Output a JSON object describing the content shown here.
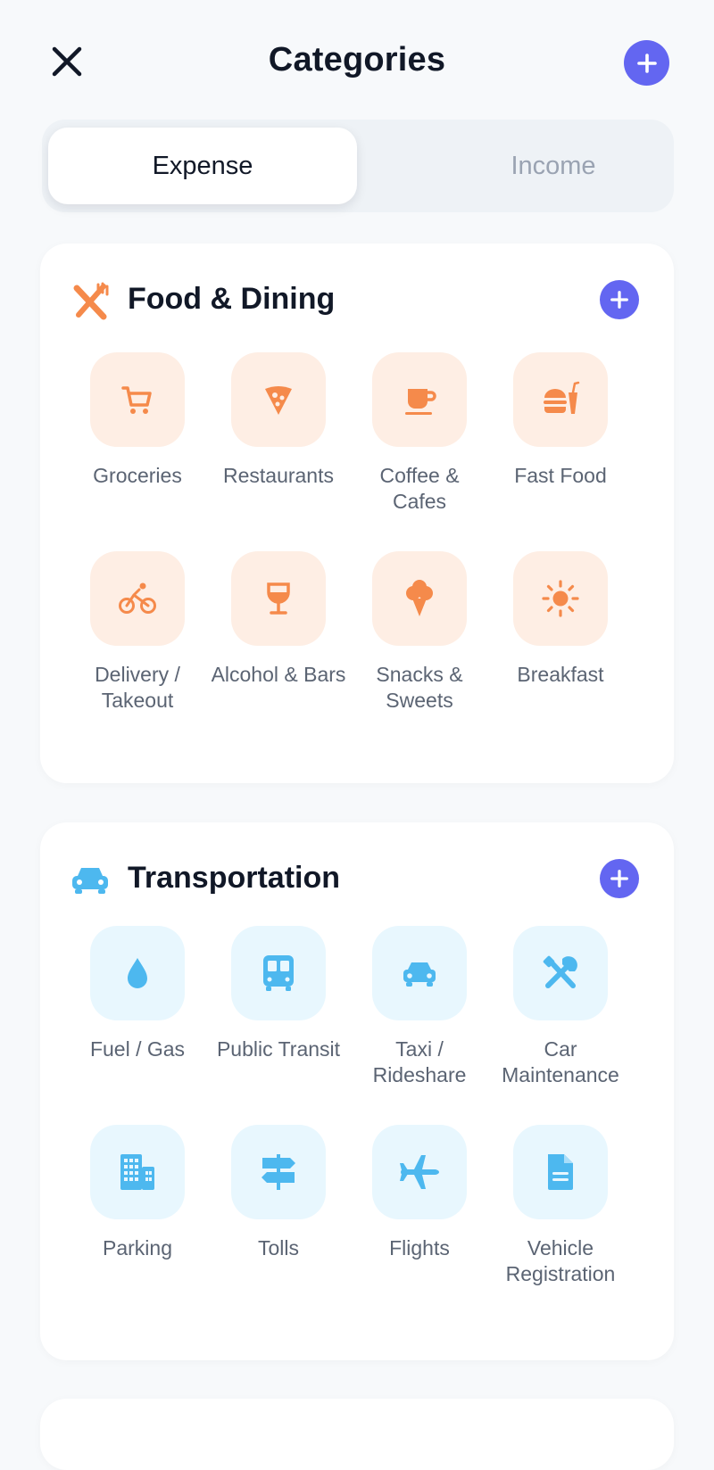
{
  "header": {
    "title": "Categories",
    "close_icon": "close-icon",
    "add_icon": "plus-icon"
  },
  "tabs": [
    {
      "label": "Expense",
      "active": true
    },
    {
      "label": "Income",
      "active": false
    }
  ],
  "colors": {
    "accent": "#6366f1",
    "food": "#f58a4b",
    "food_bg": "#feeee4",
    "transport": "#4db8ef",
    "transport_bg": "#e8f7fe"
  },
  "sections": [
    {
      "title": "Food & Dining",
      "icon": "fork-knife-icon",
      "items": [
        {
          "label": "Groceries",
          "icon": "cart-icon"
        },
        {
          "label": "Restaurants",
          "icon": "pizza-icon"
        },
        {
          "label": "Coffee & Cafes",
          "icon": "coffee-icon"
        },
        {
          "label": "Fast Food",
          "icon": "burger-icon"
        },
        {
          "label": "Delivery / Takeout",
          "icon": "bicycle-icon"
        },
        {
          "label": "Alcohol & Bars",
          "icon": "wine-glass-icon"
        },
        {
          "label": "Snacks & Sweets",
          "icon": "ice-cream-icon"
        },
        {
          "label": "Breakfast",
          "icon": "sun-icon"
        }
      ]
    },
    {
      "title": "Transportation",
      "icon": "car-icon",
      "items": [
        {
          "label": "Fuel / Gas",
          "icon": "drop-icon"
        },
        {
          "label": "Public Transit",
          "icon": "bus-icon"
        },
        {
          "label": "Taxi / Rideshare",
          "icon": "taxi-icon"
        },
        {
          "label": "Car Maintenance",
          "icon": "tools-icon"
        },
        {
          "label": "Parking",
          "icon": "building-icon"
        },
        {
          "label": "Tolls",
          "icon": "signpost-icon"
        },
        {
          "label": "Flights",
          "icon": "airplane-icon"
        },
        {
          "label": "Vehicle Registration",
          "icon": "document-icon"
        }
      ]
    }
  ]
}
